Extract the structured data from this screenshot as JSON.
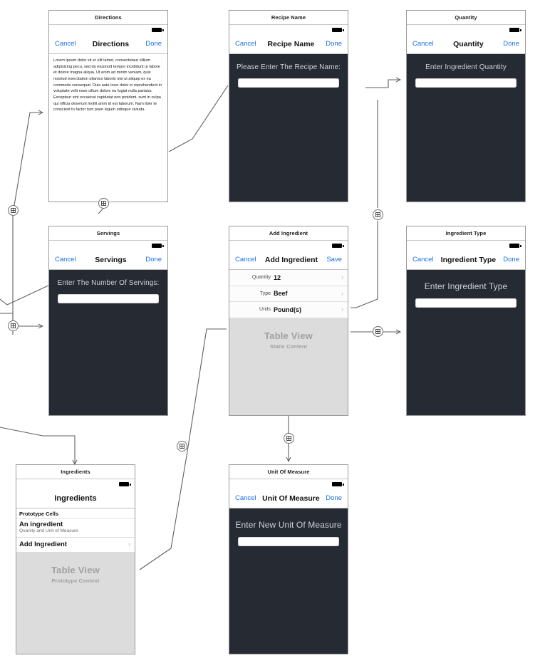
{
  "document": {
    "kind": "storyboard-canvas",
    "tool": "interface-builder"
  },
  "scenes": [
    {
      "id": "directions",
      "scene_title": "Directions",
      "nav": {
        "left": "Cancel",
        "title": "Directions",
        "right": "Done"
      },
      "body_type": "text-document",
      "text": "Lorem ipsum dolor sit er elit lamet, consectetaur cillium adipisicing pecu, sed do eiusmod tempor incididunt ut labore et dolore magna aliqua. Ut enim ad minim veniam, quis nostrud exercitation ullamco laboris nisi ut aliquip ex ea commodo consequat. Duis aute irure dolor in reprehenderit in voluptate velit esse cillum dolore eu fugiat nulla pariatur. Excepteur sint occaecat cupidatat non proident, sunt in culpa qui officia deserunt mollit anim id est laborum. Nam liber te conscient to factor tum poen legum odioque civiuda."
    },
    {
      "id": "recipe-name",
      "scene_title": "Recipe Name",
      "nav": {
        "left": "Cancel",
        "title": "Recipe Name",
        "right": "Done"
      },
      "body_type": "prompt-field",
      "prompt": "Please Enter The Recipe Name:",
      "field_value": "",
      "field_placeholder": ""
    },
    {
      "id": "quantity",
      "scene_title": "Quantity",
      "nav": {
        "left": "Cancel",
        "title": "Quantity",
        "right": "Done"
      },
      "body_type": "prompt-field",
      "prompt": "Enter Ingredient Quantity",
      "field_value": "",
      "field_placeholder": ""
    },
    {
      "id": "servings",
      "scene_title": "Servings",
      "nav": {
        "left": "Cancel",
        "title": "Servings",
        "right": "Done"
      },
      "body_type": "prompt-field",
      "prompt": "Enter The Number Of Servings:",
      "field_value": "",
      "field_placeholder": ""
    },
    {
      "id": "add-ingredient",
      "scene_title": "Add Ingredient",
      "nav": {
        "left": "Cancel",
        "title": "Add Ingredient",
        "right": "Save"
      },
      "body_type": "static-table",
      "rows": [
        {
          "label": "Quantity",
          "value": "12",
          "accessory": "›"
        },
        {
          "label": "Type",
          "value": "Beef",
          "accessory": "›"
        },
        {
          "label": "Units",
          "value": "Pound(s)",
          "accessory": "›"
        }
      ],
      "placeholder": {
        "title": "Table View",
        "subtitle": "Static Content"
      }
    },
    {
      "id": "ingredient-type",
      "scene_title": "Ingredient Type",
      "nav": {
        "left": "Cancel",
        "title": "Ingredient Type",
        "right": "Done"
      },
      "body_type": "prompt-field",
      "prompt": "Enter Ingredient Type",
      "field_value": "",
      "field_placeholder": ""
    },
    {
      "id": "ingredients",
      "scene_title": "Ingredients",
      "nav": {
        "left": "",
        "title": "Ingredients",
        "right": ""
      },
      "body_type": "prototype-table",
      "prototype_header": "Prototype Cells",
      "prototype_cells": [
        {
          "main": "An ingredient",
          "sub": "Quanity and Unit of Measure"
        },
        {
          "main": "Add Ingredient",
          "sub": "",
          "accessory": "›"
        }
      ],
      "placeholder": {
        "title": "Table View",
        "subtitle": "Prototype Content"
      }
    },
    {
      "id": "unit-of-measure",
      "scene_title": "Unit Of Measure",
      "nav": {
        "left": "Cancel",
        "title": "Unit Of Measure",
        "right": "Done"
      },
      "body_type": "prompt-field",
      "prompt": "Enter New Unit Of Measure",
      "field_value": "",
      "field_placeholder": ""
    }
  ],
  "colors": {
    "tint": "#1a6fe8",
    "dark_body": "#262a33",
    "placeholder_gray": "#dcdcdc",
    "placeholder_text": "#a0a0a0",
    "connection_line": "#5f5f5f",
    "scene_border": "#9a9a9a"
  },
  "segue_count": 7
}
